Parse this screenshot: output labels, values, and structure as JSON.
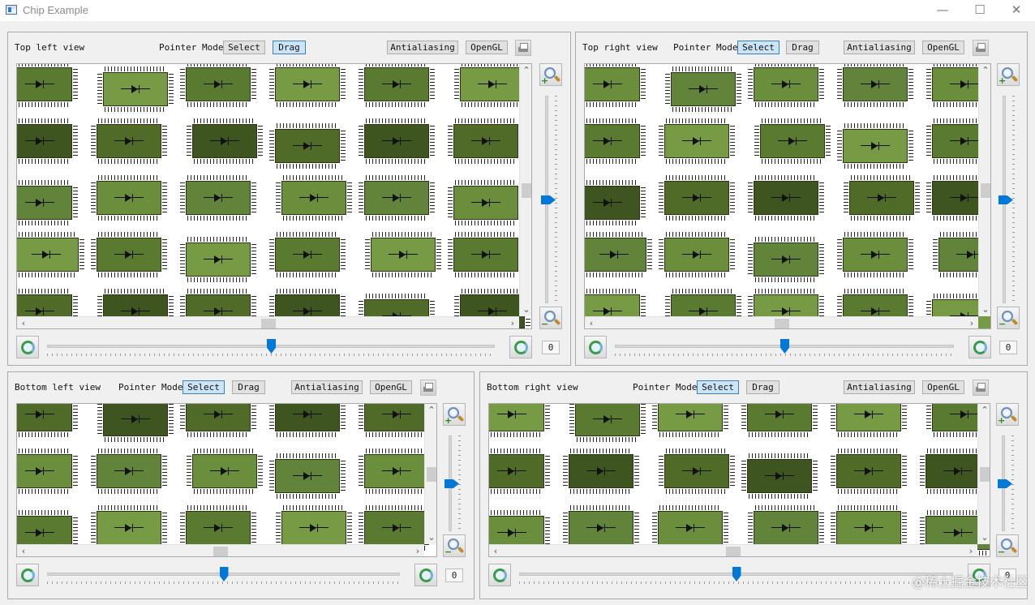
{
  "window": {
    "title": "Chip Example",
    "controls": [
      "—",
      "☐",
      "✕"
    ]
  },
  "views": [
    {
      "label": "Top left view",
      "pointer_mode_label": "Pointer Mode",
      "select_label": "Select",
      "drag_label": "Drag",
      "active_mode": "drag",
      "antialiasing_label": "Antialiasing",
      "opengl_label": "OpenGL",
      "rotate_value": "0",
      "zoom_level": 0.5,
      "rotate_level": 0.5
    },
    {
      "label": "Top right view",
      "pointer_mode_label": "Pointer Mode",
      "select_label": "Select",
      "drag_label": "Drag",
      "active_mode": "select",
      "antialiasing_label": "Antialiasing",
      "opengl_label": "OpenGL",
      "rotate_value": "0",
      "zoom_level": 0.5,
      "rotate_level": 0.5
    },
    {
      "label": "Bottom left view",
      "pointer_mode_label": "Pointer Mode",
      "select_label": "Select",
      "drag_label": "Drag",
      "active_mode": "select",
      "antialiasing_label": "Antialiasing",
      "opengl_label": "OpenGL",
      "rotate_value": "0",
      "zoom_level": 0.5,
      "rotate_level": 0.5
    },
    {
      "label": "Bottom right view",
      "pointer_mode_label": "Pointer Mode",
      "select_label": "Select",
      "drag_label": "Drag",
      "active_mode": "select",
      "antialiasing_label": "Antialiasing",
      "opengl_label": "OpenGL",
      "rotate_value": "0",
      "zoom_level": 0.5,
      "rotate_level": 0.5
    }
  ],
  "chip_colors": [
    "#5a7a2f",
    "#6b8e3c",
    "#4f6b27",
    "#779b45",
    "#62843a",
    "#3f5520"
  ],
  "watermark": "@稀土掘金技术社区"
}
